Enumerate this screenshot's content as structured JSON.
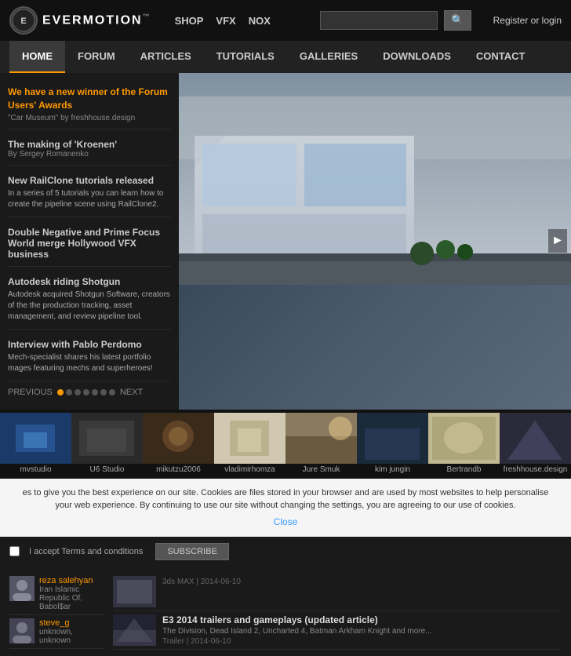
{
  "brand": {
    "name": "EVERMOTION",
    "tm": "™"
  },
  "top_nav": {
    "items": [
      "SHOP",
      "VFX",
      "NOX"
    ]
  },
  "search": {
    "placeholder": ""
  },
  "register": {
    "label": "Register or login"
  },
  "main_nav": {
    "items": [
      {
        "label": "HOME",
        "active": true
      },
      {
        "label": "FORUM",
        "active": false
      },
      {
        "label": "ARTICLES",
        "active": false
      },
      {
        "label": "TUTORIALS",
        "active": false
      },
      {
        "label": "GALLERIES",
        "active": false
      },
      {
        "label": "DOWNLOADS",
        "active": false
      },
      {
        "label": "CONTACT",
        "active": false
      }
    ]
  },
  "sidebar": {
    "articles": [
      {
        "type": "highlight",
        "title": "We have a new winner of the Forum Users' Awards",
        "sub": "\"Car Museum\" by freshhouse.design"
      },
      {
        "type": "normal",
        "title": "The making of 'Kroenen'",
        "sub": "By Sergey Romanenko"
      },
      {
        "type": "normal",
        "title": "New RailClone tutorials released",
        "desc": "In a series of 5 tutorials you can learn how to create the pipeline scene using RailClone2."
      },
      {
        "type": "normal",
        "title": "Double Negative and Prime Focus World merge Hollywood VFX business"
      },
      {
        "type": "normal",
        "title": "Autodesk riding Shotgun",
        "desc": "Autodesk acquired Shotgun Software, creators of the the production tracking, asset management, and review pipeline tool."
      },
      {
        "type": "normal",
        "title": "Interview with Pablo Perdomo",
        "desc": "Mech-specialist shares his latest portfolio mages featuring mechs and superheroes!"
      }
    ],
    "prev_label": "PREVIOUS",
    "next_label": "NEXT"
  },
  "gallery": {
    "thumbs": [
      {
        "label": "mvstudio",
        "color": "#1a3a6a"
      },
      {
        "label": "U6 Studio",
        "color": "#2a2a2a"
      },
      {
        "label": "mikutzu2006",
        "color": "#3a2a1a"
      },
      {
        "label": "vladimirhomza",
        "color": "#2a3a2a"
      },
      {
        "label": "Jure Smuk",
        "color": "#4a3a2a"
      },
      {
        "label": "kim jungin",
        "color": "#1a2a3a"
      },
      {
        "label": "Bertrandb",
        "color": "#3a3a4a"
      },
      {
        "label": "freshhouse.design",
        "color": "#2a2a3a"
      }
    ]
  },
  "cookie_bar": {
    "text": "es to give you the best experience on our site. Cookies are files stored in your browser and are used by most websites to help personalise your web experience. By continuing to use our site without changing the settings, you are agreeing to our use of cookies.",
    "close_label": "Close"
  },
  "bottom": {
    "users": [
      {
        "name": "reza salehyan",
        "location": "Iran Islamic Republic Of, Babol$ar"
      },
      {
        "name": "steve_g",
        "location": "unknown, unknown"
      }
    ],
    "articles": [
      {
        "title": "3ds MAX  |  2014-06-10",
        "color": "#556"
      },
      {
        "title": "E3 2014 trailers and gameplays (updated article)",
        "desc": "The Division, Dead Island 2, Uncharted 4, Batman Arkham Knight and more...",
        "meta": "Trailer  |  2014-06-10",
        "color": "#334"
      }
    ]
  },
  "subscribe": {
    "checkbox_label": "I accept Terms and conditions",
    "button_label": "SUBSCRIBE"
  }
}
